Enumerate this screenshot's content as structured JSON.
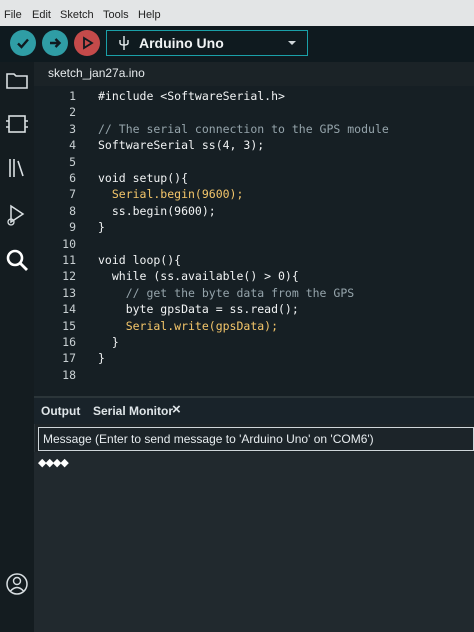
{
  "menu": [
    "File",
    "Edit",
    "Sketch",
    "Tools",
    "Help"
  ],
  "toolbar": {
    "board": "Arduino Uno",
    "verify_icon": "check-icon",
    "upload_icon": "arrow-right-icon",
    "debug_icon": "debug-play-icon"
  },
  "sidebar": {
    "icons": [
      "folder-icon",
      "board-manager-icon",
      "library-icon",
      "debug-icon",
      "search-icon",
      "account-icon"
    ]
  },
  "editor": {
    "filename": "sketch_jan27a.ino",
    "lines": [
      {
        "n": "1",
        "text": "#include <SoftwareSerial.h>",
        "style": "kw"
      },
      {
        "n": "2",
        "text": "",
        "style": "kw"
      },
      {
        "n": "3",
        "text": "// The serial connection to the GPS module",
        "style": "cm"
      },
      {
        "n": "4",
        "text": "SoftwareSerial ss(4, 3);",
        "style": "kw"
      },
      {
        "n": "5",
        "text": "",
        "style": "kw"
      },
      {
        "n": "6",
        "text": "void setup(){",
        "style": "kw"
      },
      {
        "n": "7",
        "text": "  Serial.begin(9600);",
        "style": "fn"
      },
      {
        "n": "8",
        "text": "  ss.begin(9600);",
        "style": "kw"
      },
      {
        "n": "9",
        "text": "}",
        "style": "kw"
      },
      {
        "n": "10",
        "text": "",
        "style": "kw"
      },
      {
        "n": "11",
        "text": "void loop(){",
        "style": "kw"
      },
      {
        "n": "12",
        "text": "  while (ss.available() > 0){",
        "style": "kw"
      },
      {
        "n": "13",
        "text": "    // get the byte data from the GPS",
        "style": "cm"
      },
      {
        "n": "14",
        "text": "    byte gpsData = ss.read();",
        "style": "kw"
      },
      {
        "n": "15",
        "text": "    Serial.write(gpsData);",
        "style": "fn"
      },
      {
        "n": "16",
        "text": "  }",
        "style": "kw"
      },
      {
        "n": "17",
        "text": "}",
        "style": "kw"
      },
      {
        "n": "18",
        "text": "",
        "style": "kw"
      }
    ]
  },
  "panel": {
    "tab_output": "Output",
    "tab_serial": "Serial Monitor",
    "close": "×",
    "message_placeholder": "Message (Enter to send message to 'Arduino Uno' on 'COM6')",
    "serial_output": "◆◆◆◆"
  },
  "colors": {
    "accent": "#1aa0a8",
    "button": "#2f9da5",
    "debug_button": "#c44a4a"
  }
}
